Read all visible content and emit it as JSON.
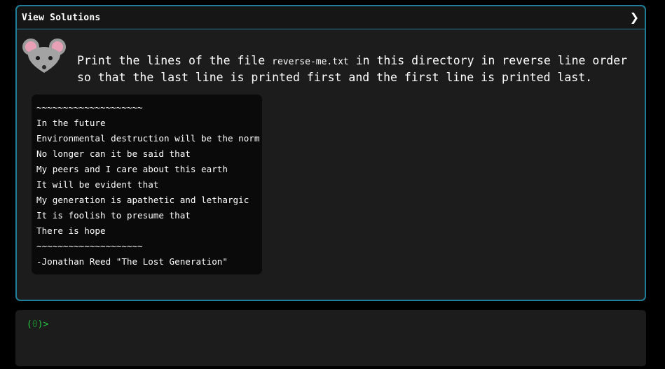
{
  "panel": {
    "header_title": "View Solutions",
    "chevron": "❯"
  },
  "avatar": {
    "icon": "mouse-icon"
  },
  "instruction": {
    "before": "Print the lines of the file ",
    "filename": "reverse-me.txt",
    "after": " in this directory in reverse line order so that the last line is printed first and the first line is printed last."
  },
  "poem": {
    "lines": [
      "~~~~~~~~~~~~~~~~~~~~",
      "In the future",
      "Environmental destruction will be the norm",
      "No longer can it be said that",
      "My peers and I care about this earth",
      "It will be evident that",
      "My generation is apathetic and lethargic",
      "It is foolish to presume that",
      "There is hope",
      "~~~~~~~~~~~~~~~~~~~~",
      "-Jonathan Reed \"The Lost Generation\""
    ]
  },
  "terminal": {
    "prompt_open": "(",
    "exit_code": "0",
    "prompt_close": ")>",
    "input_value": ""
  },
  "colors": {
    "panel_border": "#1f7f99",
    "panel_bg": "#1c1c1c",
    "code_bg": "#0a0a0a",
    "prompt_green": "#27c93f"
  }
}
